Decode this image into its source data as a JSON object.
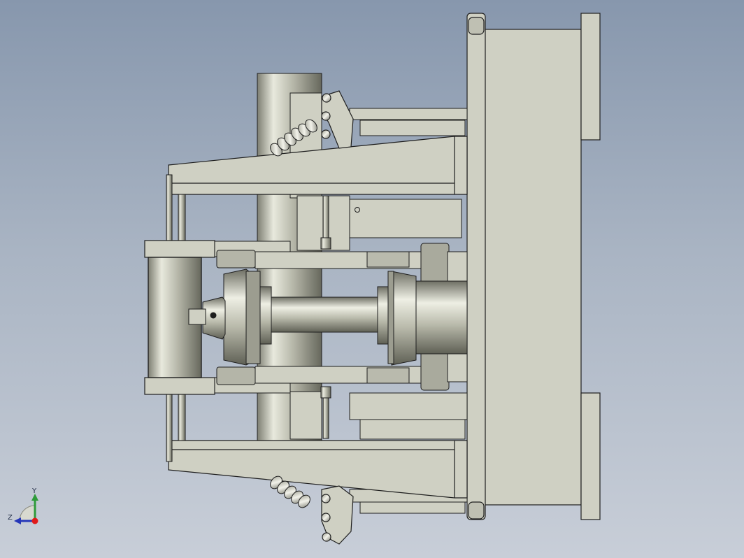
{
  "viewport": {
    "background_top": "#8797ad",
    "background_bottom": "#c8ced8",
    "part_fill": "#cfd0c3",
    "part_stroke": "#1e1e1e"
  },
  "triad": {
    "y_label": "Y",
    "z_label": "Z",
    "y_axis_color": "#2e9b3a",
    "z_axis_color": "#2536b8",
    "x_point_color": "#e01a1a"
  }
}
